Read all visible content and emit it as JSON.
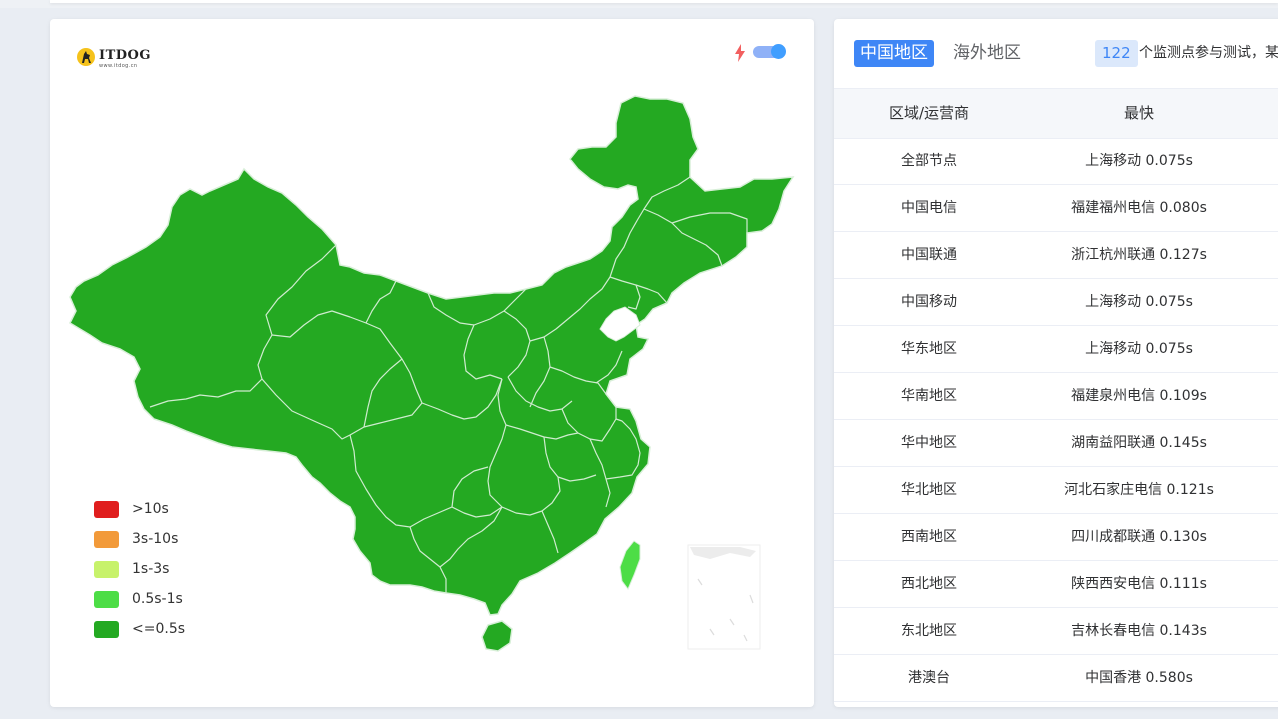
{
  "map_panel": {
    "logo": {
      "text": "ITDOG",
      "sub": "www.itdog.cn"
    },
    "colors": {
      "fast": "#24a922",
      "taiwan": "#4ddd46",
      "border": "#d8efd8"
    },
    "legend": [
      {
        "label": ">10s",
        "color": "#e01e1e"
      },
      {
        "label": "3s-10s",
        "color": "#f29a3a"
      },
      {
        "label": "1s-3s",
        "color": "#c7f26b"
      },
      {
        "label": "0.5s-1s",
        "color": "#4ddd46"
      },
      {
        "label": "<=0.5s",
        "color": "#24a922"
      }
    ]
  },
  "results_panel": {
    "tabs": [
      {
        "label": "中国地区",
        "active": true
      },
      {
        "label": "海外地区",
        "active": false
      }
    ],
    "probe_count": "122",
    "probe_text": "个监测点参与测试，某",
    "headers": [
      "区域/运营商",
      "最快"
    ],
    "rows": [
      {
        "region": "全部节点",
        "fastest": "上海移动 0.075s"
      },
      {
        "region": "中国电信",
        "fastest": "福建福州电信 0.080s"
      },
      {
        "region": "中国联通",
        "fastest": "浙江杭州联通 0.127s"
      },
      {
        "region": "中国移动",
        "fastest": "上海移动 0.075s"
      },
      {
        "region": "华东地区",
        "fastest": "上海移动 0.075s"
      },
      {
        "region": "华南地区",
        "fastest": "福建泉州电信 0.109s"
      },
      {
        "region": "华中地区",
        "fastest": "湖南益阳联通 0.145s"
      },
      {
        "region": "华北地区",
        "fastest": "河北石家庄电信 0.121s"
      },
      {
        "region": "西南地区",
        "fastest": "四川成都联通 0.130s"
      },
      {
        "region": "西北地区",
        "fastest": "陕西西安电信 0.111s"
      },
      {
        "region": "东北地区",
        "fastest": "吉林长春电信 0.143s"
      },
      {
        "region": "港澳台",
        "fastest": "中国香港 0.580s"
      }
    ]
  }
}
